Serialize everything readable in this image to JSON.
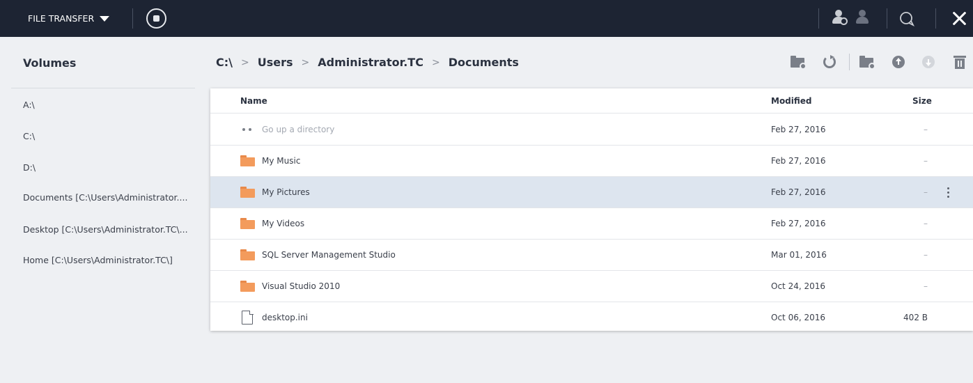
{
  "topbar": {
    "mode_label": "FILE TRANSFER",
    "icons": [
      "caret-down-icon",
      "stop-icon",
      "add-user-icon",
      "user-icon",
      "chat-icon",
      "close-icon"
    ]
  },
  "sidebar": {
    "title": "Volumes",
    "items": [
      {
        "label": "A:\\"
      },
      {
        "label": "C:\\"
      },
      {
        "label": "D:\\"
      },
      {
        "label": "Documents [C:\\Users\\Administrator...."
      },
      {
        "label": "Desktop [C:\\Users\\Administrator.TC\\..."
      },
      {
        "label": "Home [C:\\Users\\Administrator.TC\\]"
      }
    ]
  },
  "breadcrumb": {
    "separator": ">",
    "parts": [
      "C:\\",
      "Users",
      "Administrator.TC",
      "Documents"
    ]
  },
  "toolbar": {
    "icons": [
      "new-folder-icon",
      "refresh-icon",
      "new-folder-icon",
      "upload-icon",
      "download-icon",
      "trash-icon"
    ]
  },
  "table": {
    "columns": {
      "name": "Name",
      "modified": "Modified",
      "size": "Size"
    },
    "rows": [
      {
        "name": "Go up a directory",
        "modified": "Feb 27, 2016",
        "size": "–",
        "icon": "dots-icon"
      },
      {
        "name": "My Music",
        "modified": "Feb 27, 2016",
        "size": "–",
        "icon": "folder-icon"
      },
      {
        "name": "My Pictures",
        "modified": "Feb 27, 2016",
        "size": "–",
        "icon": "folder-icon",
        "selected": true
      },
      {
        "name": "My Videos",
        "modified": "Feb 27, 2016",
        "size": "–",
        "icon": "folder-icon"
      },
      {
        "name": "SQL Server Management Studio",
        "modified": "Mar 01, 2016",
        "size": "–",
        "icon": "folder-icon"
      },
      {
        "name": "Visual Studio 2010",
        "modified": "Oct 24, 2016",
        "size": "–",
        "icon": "folder-icon"
      },
      {
        "name": "desktop.ini",
        "modified": "Oct 06, 2016",
        "size": "402 B",
        "icon": "file-icon"
      }
    ]
  },
  "colors": {
    "topbar_bg": "#1d2433",
    "page_bg": "#eef0f3",
    "folder": "#f39b5c",
    "selected_row": "#dde5ef",
    "icon_gray": "#7a7f88"
  }
}
